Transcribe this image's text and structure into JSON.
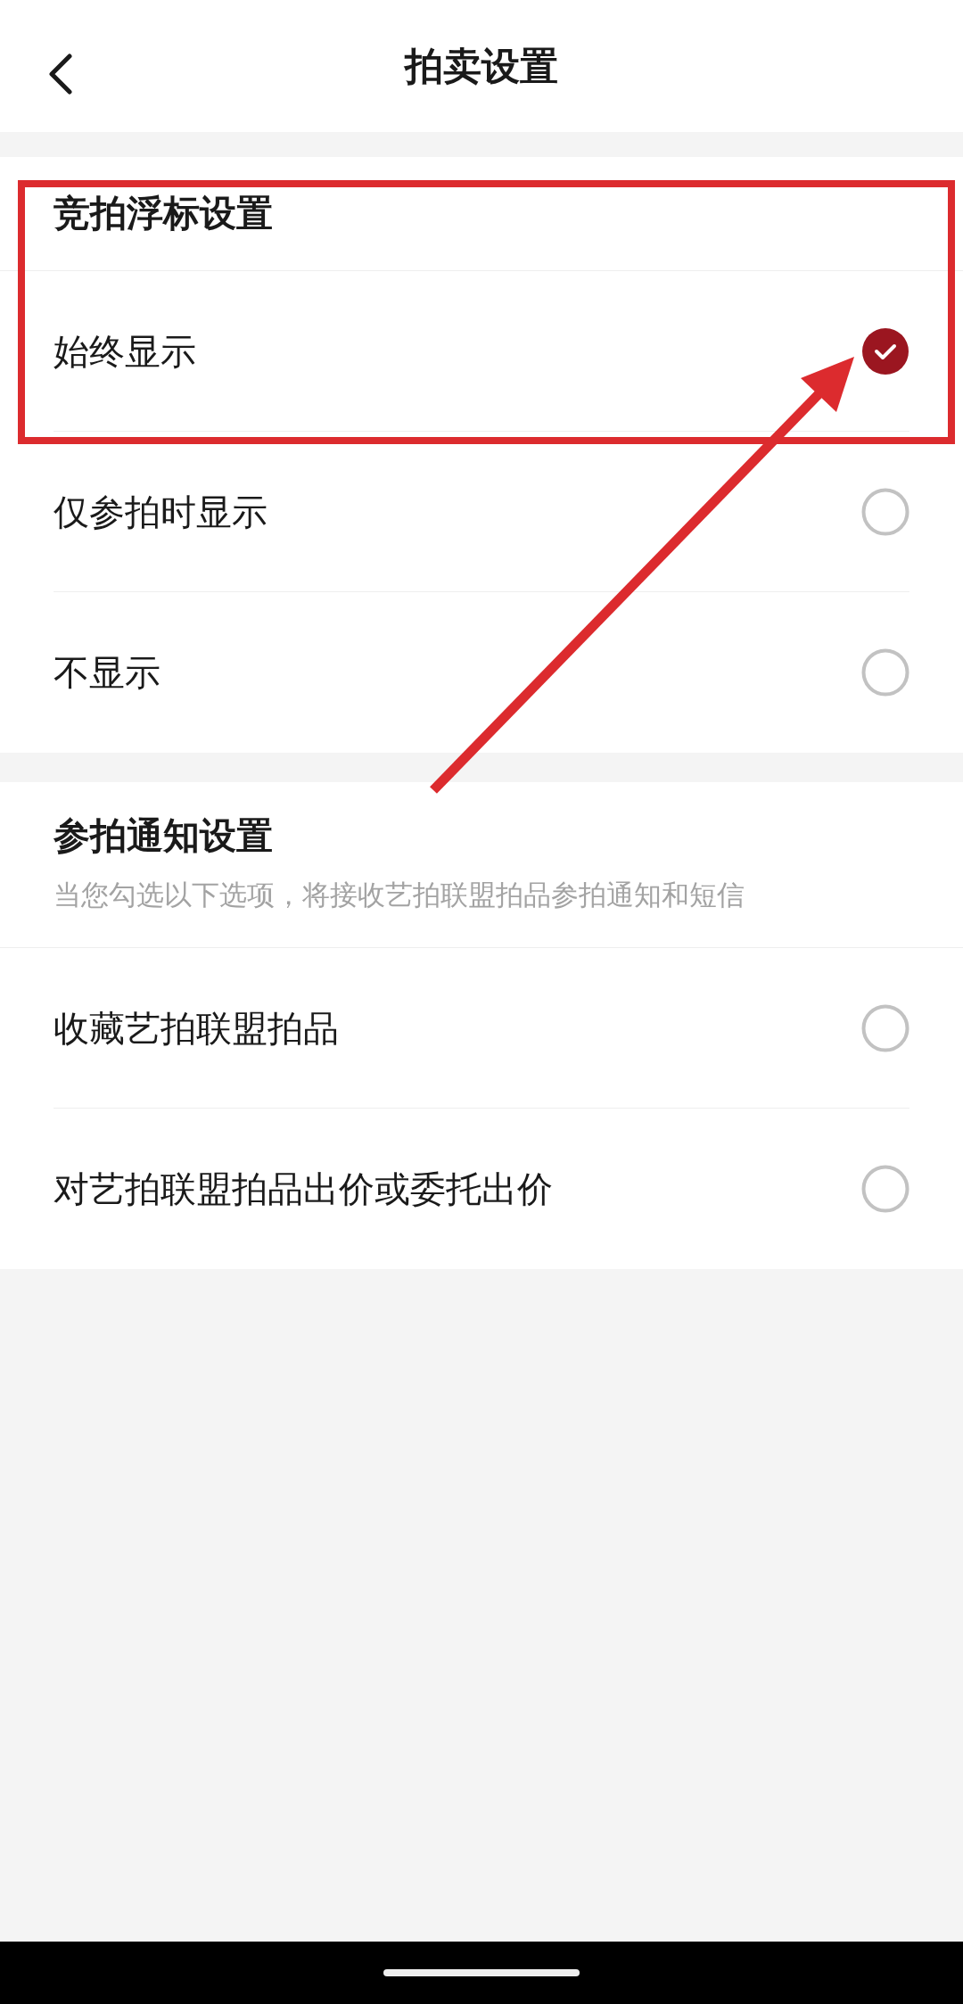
{
  "header": {
    "title": "拍卖设置"
  },
  "sections": [
    {
      "title": "竞拍浮标设置",
      "options": [
        {
          "label": "始终显示",
          "selected": true
        },
        {
          "label": "仅参拍时显示",
          "selected": false
        },
        {
          "label": "不显示",
          "selected": false
        }
      ]
    },
    {
      "title": "参拍通知设置",
      "subtitle": "当您勾选以下选项，将接收艺拍联盟拍品参拍通知和短信",
      "options": [
        {
          "label": "收藏艺拍联盟拍品",
          "selected": false
        },
        {
          "label": "对艺拍联盟拍品出价或委托出价",
          "selected": false
        }
      ]
    }
  ]
}
